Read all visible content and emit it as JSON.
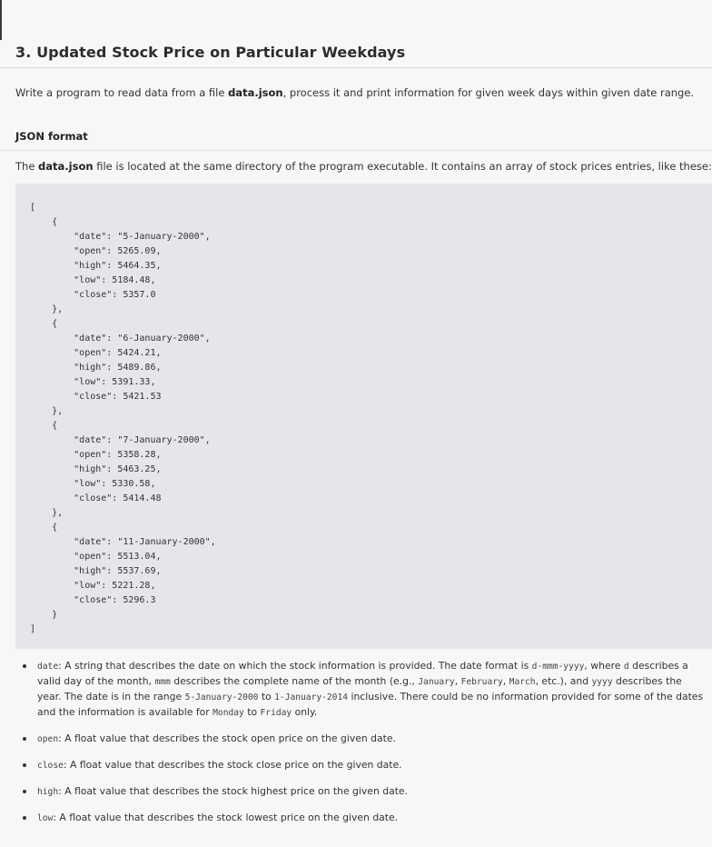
{
  "title": "3. Updated Stock Price on Particular Weekdays",
  "intro": {
    "before": "Write a program to read data from a file ",
    "file": "data.json",
    "after": ", process it and print information for given week days within given date range."
  },
  "json_section": {
    "heading": "JSON format",
    "para_before": "The ",
    "para_file": "data.json",
    "para_after": " file is located at the same directory of the program executable. It contains an array of stock prices entries, like these:"
  },
  "code_sample": "[\n    {\n        \"date\": \"5-January-2000\",\n        \"open\": 5265.09,\n        \"high\": 5464.35,\n        \"low\": 5184.48,\n        \"close\": 5357.0\n    },\n    {\n        \"date\": \"6-January-2000\",\n        \"open\": 5424.21,\n        \"high\": 5489.86,\n        \"low\": 5391.33,\n        \"close\": 5421.53\n    },\n    {\n        \"date\": \"7-January-2000\",\n        \"open\": 5358.28,\n        \"high\": 5463.25,\n        \"low\": 5330.58,\n        \"close\": 5414.48\n    },\n    {\n        \"date\": \"11-January-2000\",\n        \"open\": 5513.04,\n        \"high\": 5537.69,\n        \"low\": 5221.28,\n        \"close\": 5296.3\n    }\n]",
  "fields": {
    "date": {
      "name": "date",
      "t1": ": A string that describes the date on which the stock information is provided. The date format is ",
      "fmt": "d-mmm-yyyy",
      "t2": ", where ",
      "d": "d",
      "t3": " describes a valid day of the month, ",
      "mmm": "mmm",
      "t4": " describes the complete name of the month (e.g., ",
      "jan": "January",
      "c1": ", ",
      "feb": "February",
      "c2": ", ",
      "mar": "March",
      "t5": ", etc.), and ",
      "yyyy": "yyyy",
      "t6": " describes the year. The date is in the range ",
      "start": "5-January-2000",
      "t7": " to ",
      "end": "1-January-2014",
      "t8": " inclusive. There could be no information provided for some of the dates and the information is available for ",
      "monday": "Monday",
      "t9": " to ",
      "friday": "Friday",
      "t10": " only."
    },
    "open": {
      "name": "open",
      "desc": ": A float value that describes the stock open price on the given date."
    },
    "close": {
      "name": "close",
      "desc": ": A float value that describes the stock close price on the given date."
    },
    "high": {
      "name": "high",
      "desc": ": A float value that describes the stock highest price on the given date."
    },
    "low": {
      "name": "low",
      "desc": ": A float value that describes the stock lowest price on the given date."
    }
  }
}
